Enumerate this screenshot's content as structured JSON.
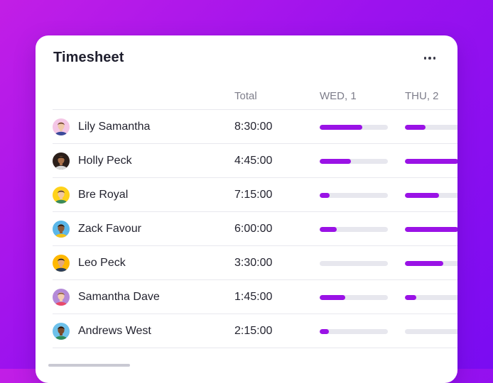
{
  "card": {
    "title": "Timesheet",
    "more_icon": "more-horizontal-icon"
  },
  "table": {
    "columns": [
      "",
      "Total",
      "WED, 1",
      "THU, 2"
    ],
    "accent_color": "#9a12e6",
    "track_color": "#e7e7ee",
    "rows": [
      {
        "name": "Lily Samantha",
        "total": "8:30:00",
        "days": [
          0.63,
          0.3
        ],
        "avatar": {
          "bg": "#f4c6e6",
          "skin": "#f0c9a8",
          "hair": "#6b3f2a",
          "shirt": "#3b4a9a"
        }
      },
      {
        "name": "Holly Peck",
        "total": "4:45:00",
        "days": [
          0.46,
          0.78
        ],
        "avatar": {
          "bg": "#2b1f1a",
          "skin": "#a8704a",
          "hair": "#1a120e",
          "shirt": "#d8d8d8"
        }
      },
      {
        "name": "Bre Royal",
        "total": "7:15:00",
        "days": [
          0.15,
          0.5
        ],
        "avatar": {
          "bg": "#ffd21a",
          "skin": "#f2c7a2",
          "hair": "#5a3a24",
          "shirt": "#3a8a5a"
        }
      },
      {
        "name": "Zack Favour",
        "total": "6:00:00",
        "days": [
          0.25,
          0.78
        ],
        "avatar": {
          "bg": "#5bb7e8",
          "skin": "#8a5a3a",
          "hair": "#1e1410",
          "shirt": "#f2c21a"
        }
      },
      {
        "name": "Leo Peck",
        "total": "3:30:00",
        "days": [
          0.0,
          0.56
        ],
        "avatar": {
          "bg": "#ffb800",
          "skin": "#e4a87a",
          "hair": "#2a1c14",
          "shirt": "#2c3e5a"
        }
      },
      {
        "name": "Samantha Dave",
        "total": "1:45:00",
        "days": [
          0.38,
          0.17
        ],
        "avatar": {
          "bg": "#b48ad8",
          "skin": "#f3cdb0",
          "hair": "#8a5a3a",
          "shirt": "#e84a6a"
        }
      },
      {
        "name": "Andrews West",
        "total": "2:15:00",
        "days": [
          0.14,
          0.0
        ],
        "avatar": {
          "bg": "#6ec1ea",
          "skin": "#7a4a2a",
          "hair": "#1a100a",
          "shirt": "#2d8a5a"
        }
      }
    ]
  }
}
